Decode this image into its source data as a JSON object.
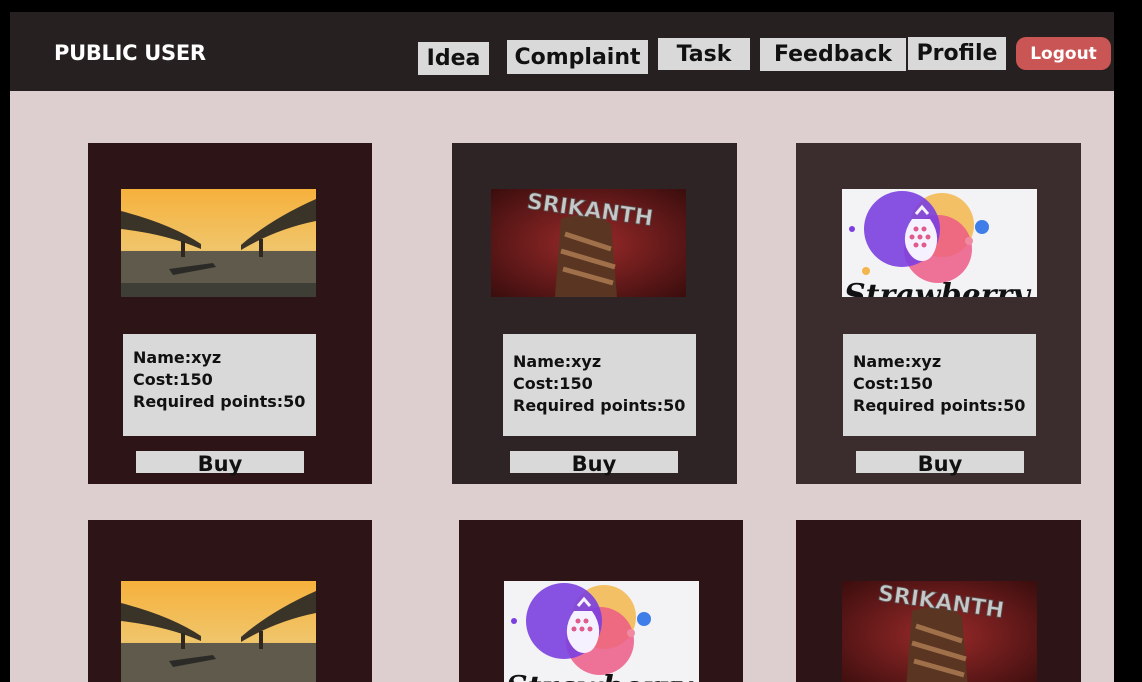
{
  "header": {
    "title": "PUBLIC USER",
    "nav": {
      "idea": "Idea",
      "complaint": "Complaint",
      "task": "Task",
      "feedback": "Feedback",
      "profile": "Profile"
    },
    "logout": "Logout"
  },
  "colors": {
    "topbar": "#262020",
    "page_background": "#ddcfcf",
    "card_dark_red": "#2d1416",
    "card_dark_brown": "#2e2425",
    "card_brown": "#3b2c2d",
    "logout": "#c95555",
    "box_gray": "#d9d9d9"
  },
  "products": [
    {
      "image": "bridge-photo",
      "name": "Name:xyz",
      "cost": "Cost:150",
      "points": "Required points:50",
      "buy": "Buy"
    },
    {
      "image": "srikanth-logo",
      "image_text": "SRIKANTH",
      "name": "Name:xyz",
      "cost": "Cost:150",
      "points": "Required points:50",
      "buy": "Buy"
    },
    {
      "image": "strawberry-logo",
      "image_text": "Strawberry",
      "name": "Name:xyz",
      "cost": "Cost:150",
      "points": "Required points:50",
      "buy": "Buy"
    },
    {
      "image": "bridge-photo"
    },
    {
      "image": "strawberry-logo",
      "image_text": "Strawberry"
    },
    {
      "image": "srikanth-logo",
      "image_text": "SRIKANTH"
    }
  ]
}
